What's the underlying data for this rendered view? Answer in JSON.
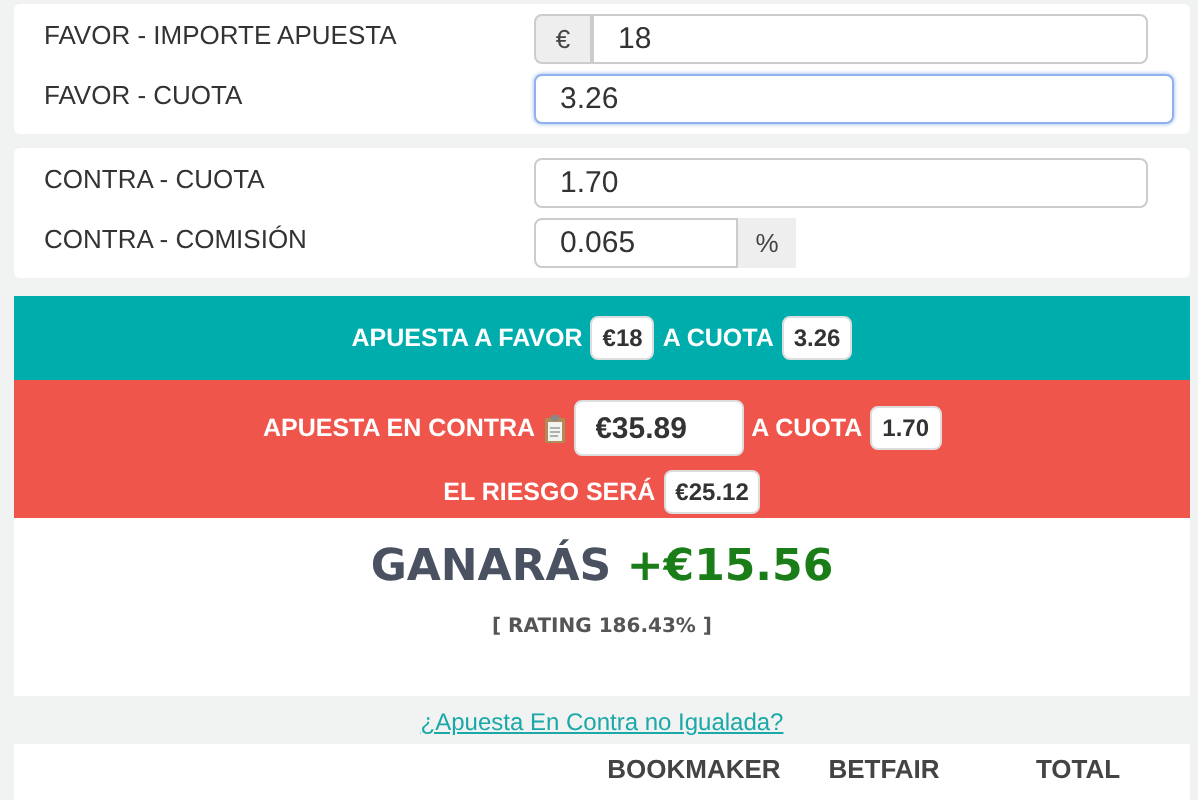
{
  "stake_card": [
    {
      "label": "FAVOR - IMPORTE APUESTA",
      "prefix": "€",
      "value": "18",
      "focused": false
    },
    {
      "label": "FAVOR - CUOTA",
      "value": "3.26",
      "focused": true
    }
  ],
  "lay_card": [
    {
      "label": "CONTRA - CUOTA",
      "value": "1.70",
      "focused": false
    },
    {
      "label": "CONTRA - COMISIÓN",
      "value": "0.065",
      "suffix": "%",
      "focused": false
    }
  ],
  "back_band": {
    "text": "APUESTA A FAVOR",
    "stake": "€18",
    "odds_label": "A CUOTA",
    "odds": "3.26"
  },
  "lay_band": {
    "text": "APUESTA EN CONTRA",
    "stake": "€35.89",
    "odds_label": "A CUOTA",
    "odds": "1.70",
    "risk_label": "EL RIESGO SERÁ",
    "risk": "€25.12"
  },
  "result": {
    "label": "GANARÁS",
    "profit": "+€15.56",
    "rating": "[ RATING 186.43% ]"
  },
  "link": "¿Apuesta En Contra no Igualada?",
  "table": {
    "columns": [
      "BOOKMAKER",
      "BETFAIR",
      "TOTAL"
    ]
  }
}
